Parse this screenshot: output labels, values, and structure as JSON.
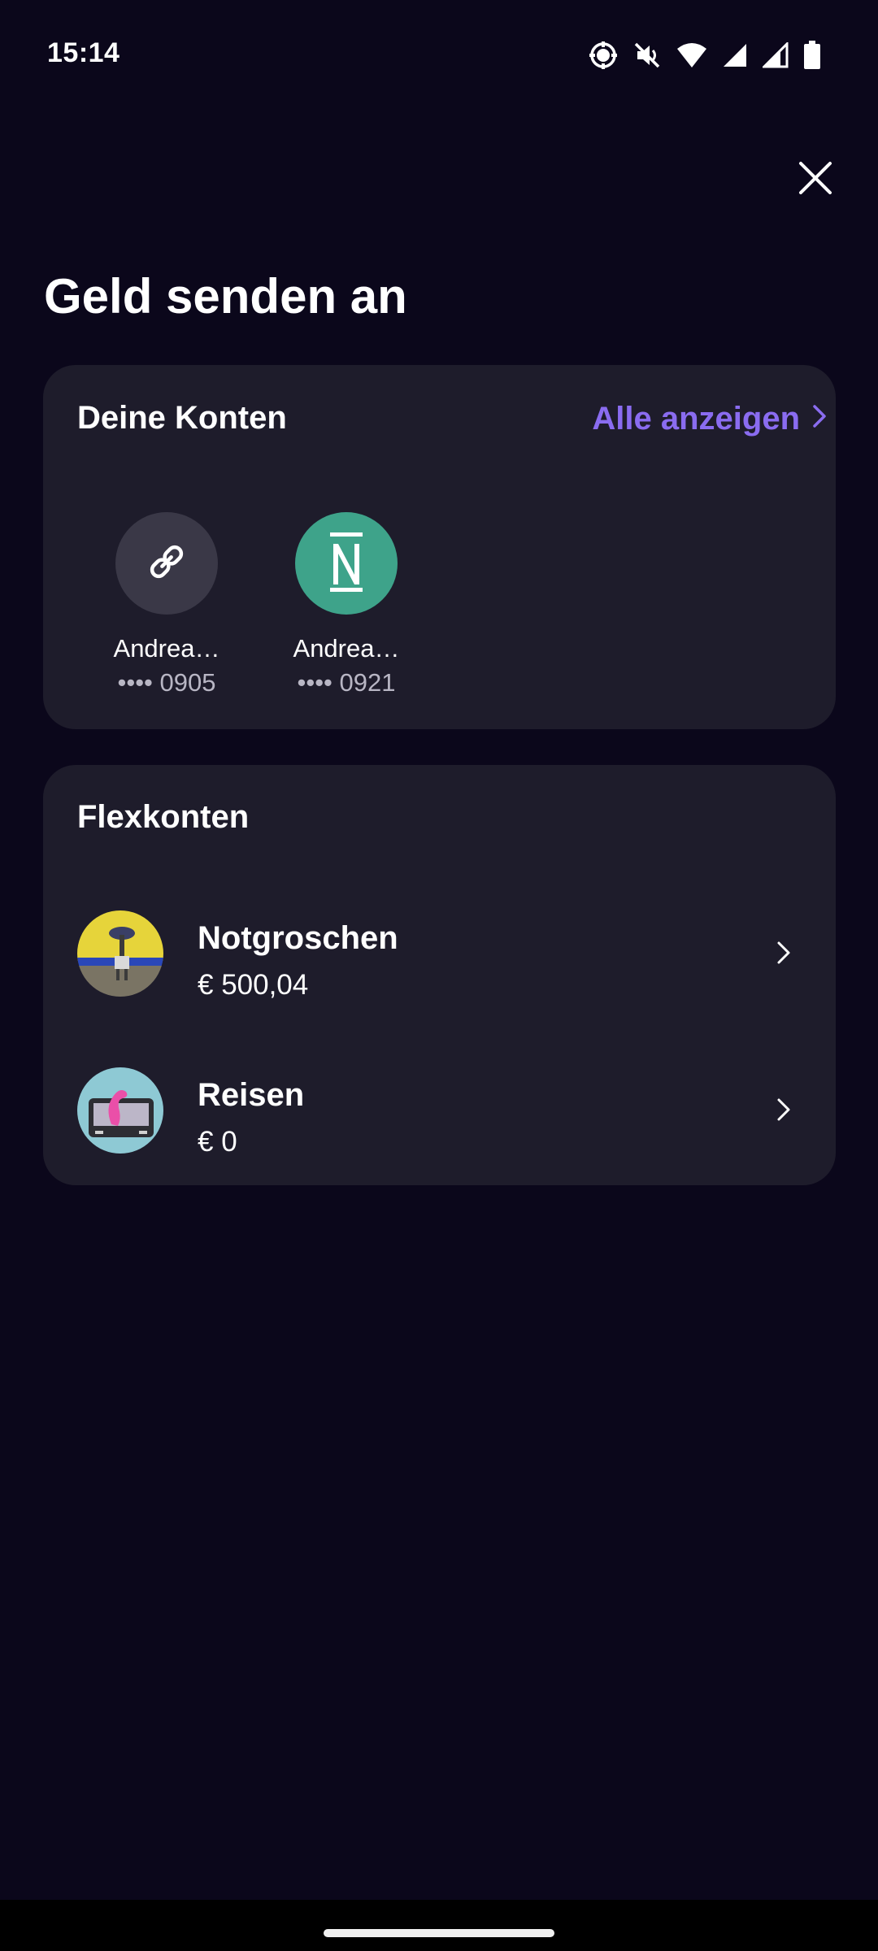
{
  "status_bar": {
    "time": "15:14"
  },
  "header": {
    "title": "Geld senden an"
  },
  "accounts_card": {
    "heading": "Deine Konten",
    "show_all_label": "Alle anzeigen",
    "accounts": [
      {
        "name": "Andrea…",
        "number": "•••• 0905",
        "avatar_icon": "link-icon",
        "avatar_color": "#3a3847"
      },
      {
        "name": "Andrea…",
        "number": "•••• 0921",
        "avatar_icon": "n26-logo",
        "avatar_color": "#3ea38a"
      }
    ]
  },
  "flex_card": {
    "heading": "Flexkonten",
    "items": [
      {
        "name": "Notgroschen",
        "amount": "€ 500,04"
      },
      {
        "name": "Reisen",
        "amount": "€ 0"
      }
    ]
  },
  "colors": {
    "background": "#0b071b",
    "card": "#1e1c2b",
    "accent": "#8a6cf0"
  }
}
